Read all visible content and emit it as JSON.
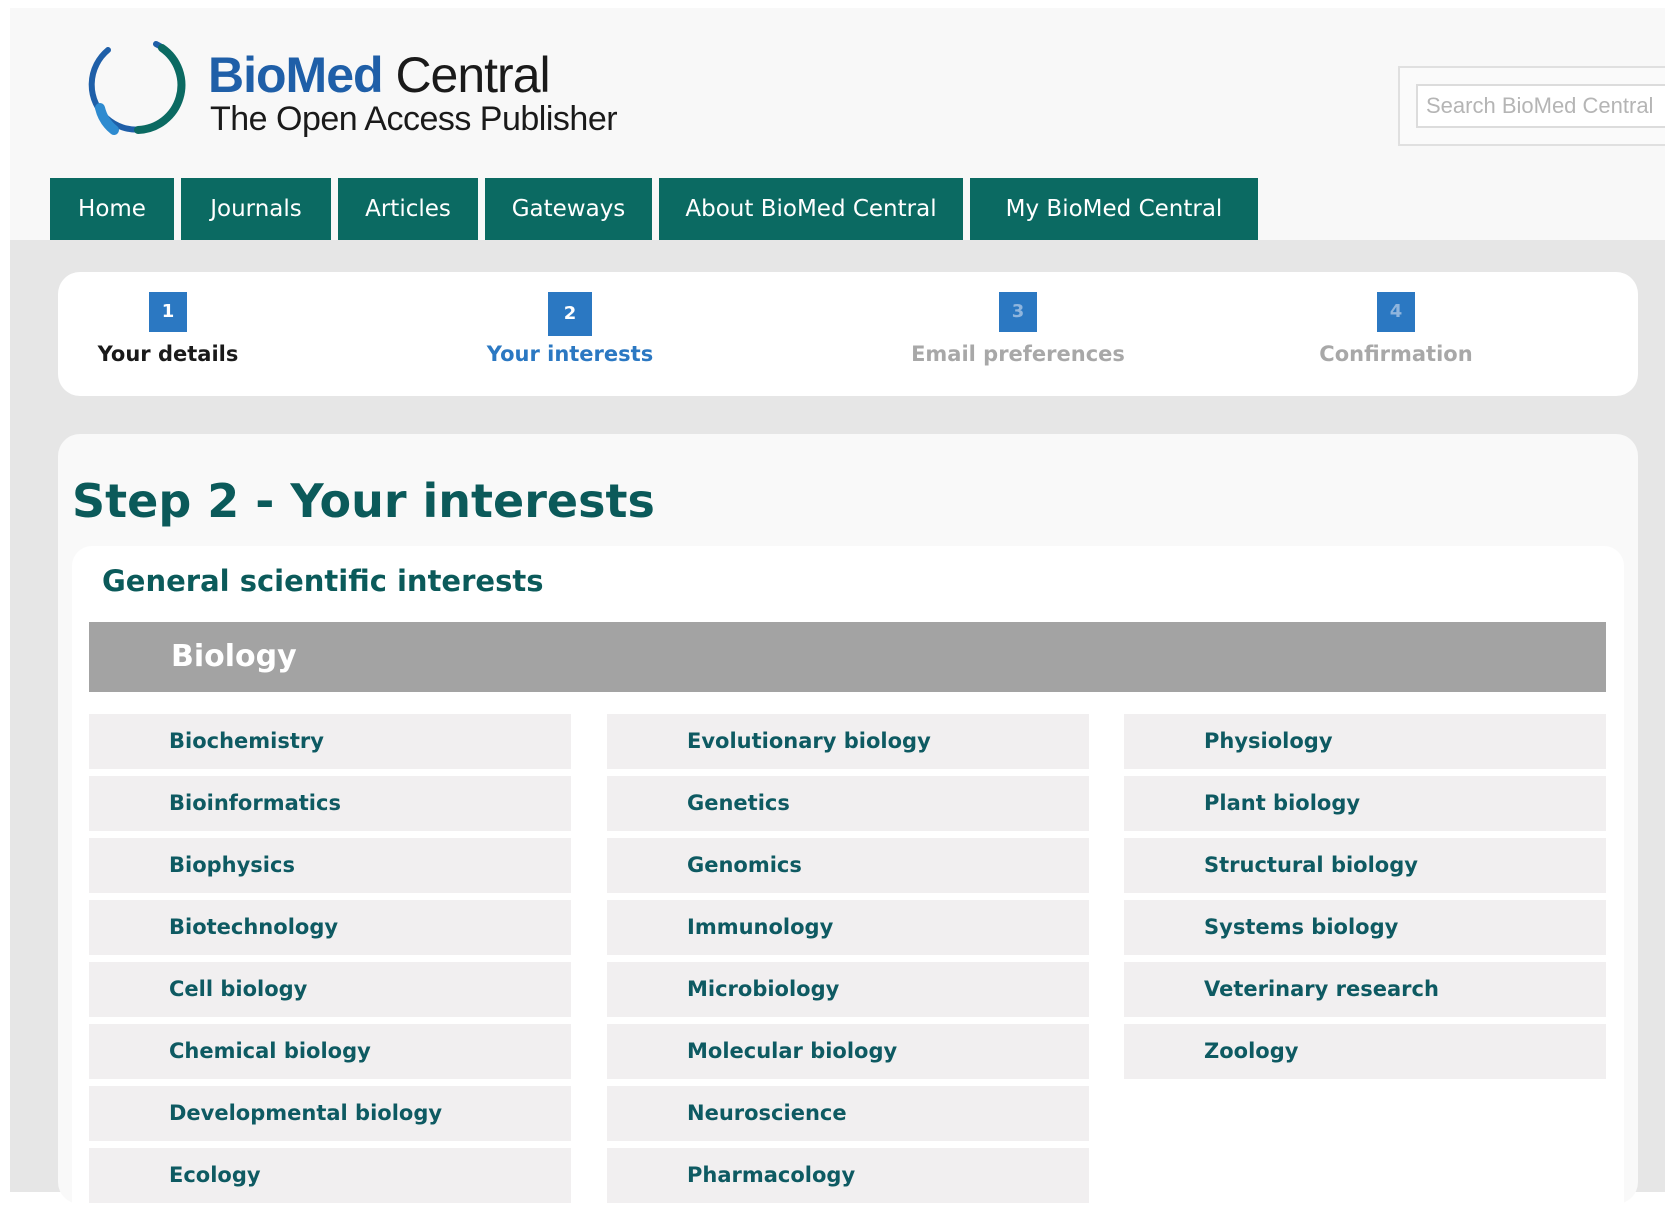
{
  "logo": {
    "brand_bio": "BioMed",
    "brand_central": " Central",
    "tagline": "The Open Access Publisher"
  },
  "search": {
    "placeholder": "Search BioMed Central"
  },
  "nav": {
    "items": [
      "Home",
      "Journals",
      "Articles",
      "Gateways",
      "About BioMed Central",
      "My BioMed Central"
    ]
  },
  "steps": [
    {
      "number": "1",
      "label": "Your details",
      "state": "completed"
    },
    {
      "number": "2",
      "label": "Your interests",
      "state": "active"
    },
    {
      "number": "3",
      "label": "Email preferences",
      "state": "upcoming"
    },
    {
      "number": "4",
      "label": "Confirmation",
      "state": "upcoming"
    }
  ],
  "main": {
    "title": "Step 2 - Your interests",
    "section_title": "General scientific interests",
    "category": "Biology",
    "topics": {
      "col1": [
        "Biochemistry",
        "Bioinformatics",
        "Biophysics",
        "Biotechnology",
        "Cell biology",
        "Chemical biology",
        "Developmental biology",
        "Ecology"
      ],
      "col2": [
        "Evolutionary biology",
        "Genetics",
        "Genomics",
        "Immunology",
        "Microbiology",
        "Molecular biology",
        "Neuroscience",
        "Pharmacology"
      ],
      "col3": [
        "Physiology",
        "Plant biology",
        "Structural biology",
        "Systems biology",
        "Veterinary research",
        "Zoology"
      ]
    }
  },
  "colors": {
    "nav_bg": "#0b6a62",
    "step_number_bg": "#2b78c2",
    "step_active": "#2b78c2",
    "step_completed": "#1a1a1a",
    "step_upcoming": "#a8a8a8",
    "heading": "#0b5a5a",
    "topic_text": "#0e5a62",
    "category_bar": "#a3a3a3",
    "topic_bg": "#f1eff0"
  }
}
